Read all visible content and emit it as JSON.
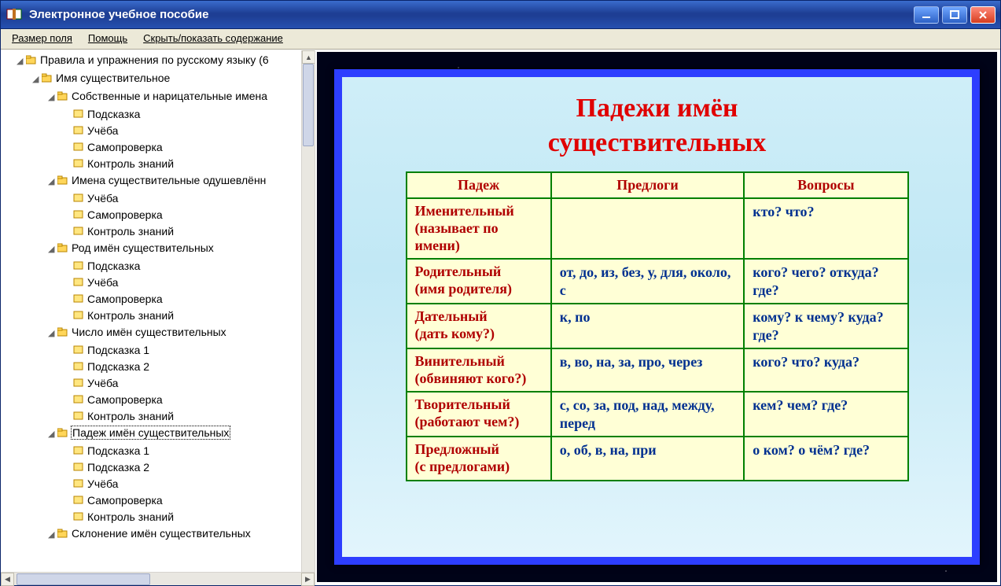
{
  "window": {
    "title": "Электронное учебное пособие"
  },
  "menu": {
    "field_size": "Размер поля",
    "help": "Помощь",
    "toggle_toc": "Скрыть/показать содержание"
  },
  "tree": {
    "root": "Правила и упражнения по русскому языку (6",
    "n1": "Имя существительное",
    "n1_1": "Собственные и нарицательные имена",
    "n1_1_1": "Подсказка",
    "n1_1_2": "Учёба",
    "n1_1_3": "Самопроверка",
    "n1_1_4": "Контроль знаний",
    "n1_2": "Имена существительные одушевлённ",
    "n1_2_1": "Учёба",
    "n1_2_2": "Самопроверка",
    "n1_2_3": "Контроль знаний",
    "n1_3": "Род имён существительных",
    "n1_3_1": "Подсказка",
    "n1_3_2": "Учёба",
    "n1_3_3": "Самопроверка",
    "n1_3_4": "Контроль знаний",
    "n1_4": "Число имён существительных",
    "n1_4_1": "Подсказка 1",
    "n1_4_2": "Подсказка 2",
    "n1_4_3": "Учёба",
    "n1_4_4": "Самопроверка",
    "n1_4_5": "Контроль знаний",
    "n1_5": "Падеж имён существительных",
    "n1_5_1": "Подсказка 1",
    "n1_5_2": "Подсказка 2",
    "n1_5_3": "Учёба",
    "n1_5_4": "Самопроверка",
    "n1_5_5": "Контроль знаний",
    "n1_6": "Склонение имён существительных"
  },
  "slide": {
    "title_line1": "Падежи имён",
    "title_line2": "существительных",
    "headers": {
      "case": "Падеж",
      "prep": "Предлоги",
      "q": "Вопросы"
    },
    "rows": [
      {
        "case1": "Именительный",
        "case2": "(называет по имени)",
        "prep": "",
        "q": "кто?  что?"
      },
      {
        "case1": "Родительный",
        "case2": "(имя родителя)",
        "prep": "от, до, из, без, у, для, около, с",
        "q": "кого?  чего?  откуда?  где?"
      },
      {
        "case1": "Дательный",
        "case2": "(дать кому?)",
        "prep": "к, по",
        "q": "кому?  к чему?  куда?  где?"
      },
      {
        "case1": "Винительный",
        "case2": "(обвиняют кого?)",
        "prep": "в, во, на, за, про, через",
        "q": "кого?  что?  куда?"
      },
      {
        "case1": "Творительный",
        "case2": "(работают чем?)",
        "prep": "с, со, за, под, над, между, перед",
        "q": "кем?  чем?  где?"
      },
      {
        "case1": "Предложный",
        "case2": "(с предлогами)",
        "prep": "о, об, в, на, при",
        "q": "о ком?  о чём?  где?"
      }
    ]
  }
}
